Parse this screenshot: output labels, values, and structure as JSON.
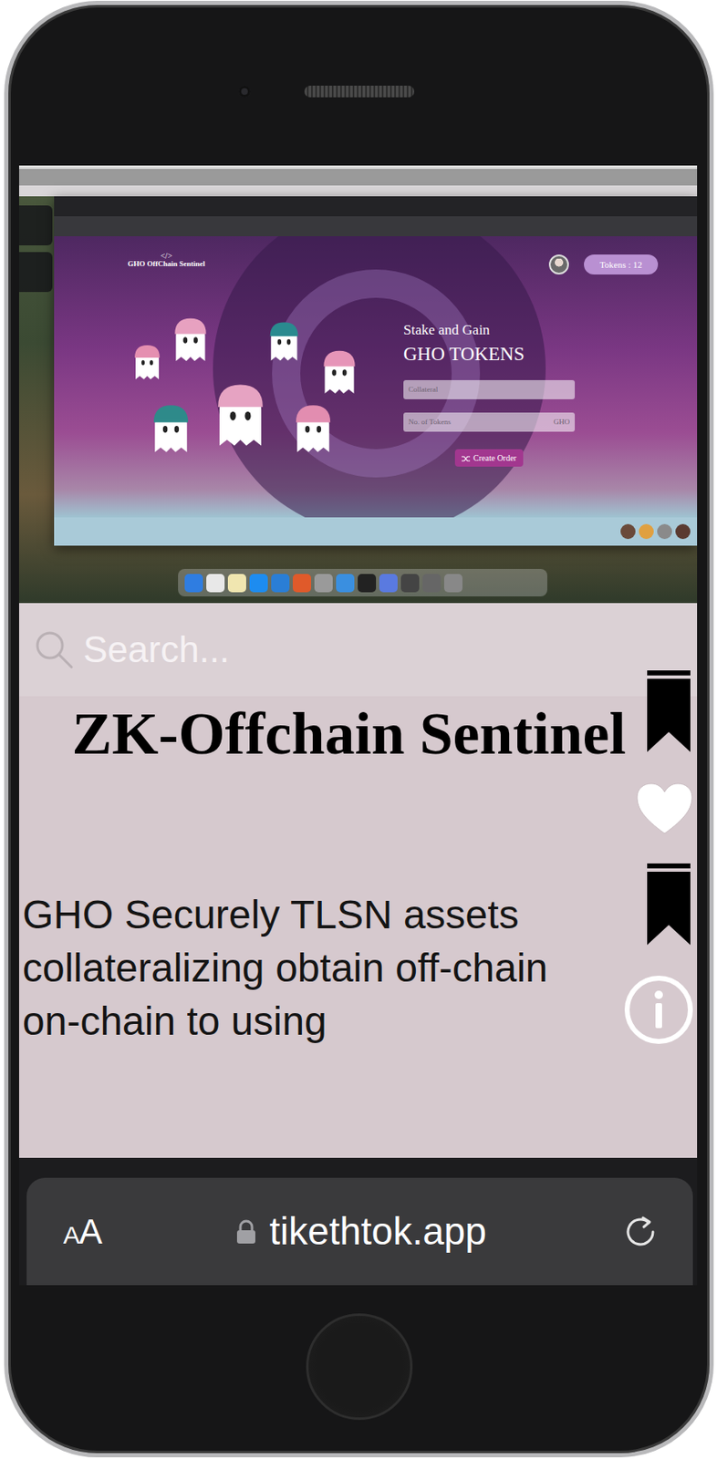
{
  "video": {
    "logo_mark": "</>",
    "logo": "GHO OffChain Sentinel",
    "tokens": "Tokens : 12",
    "heading": "Stake and Gain",
    "subheading": "GHO TOKENS",
    "fields": [
      {
        "placeholder": "Collateral"
      },
      {
        "placeholder": "No. of Tokens",
        "suffix": "GHO"
      }
    ],
    "button": "Create Order"
  },
  "search": {
    "placeholder": "Search..."
  },
  "post": {
    "title": "ZK-Offchain Sentinel",
    "lines": [
      "GHO Securely TLSN assets",
      "collateralizing obtain off-chain",
      "on-chain to using"
    ]
  },
  "actions": [
    {
      "kind": "bookmark"
    },
    {
      "kind": "heart"
    },
    {
      "kind": "bookmark"
    },
    {
      "kind": "info"
    }
  ],
  "browser": {
    "text_size": "AA",
    "url": "tikethtok.app"
  }
}
